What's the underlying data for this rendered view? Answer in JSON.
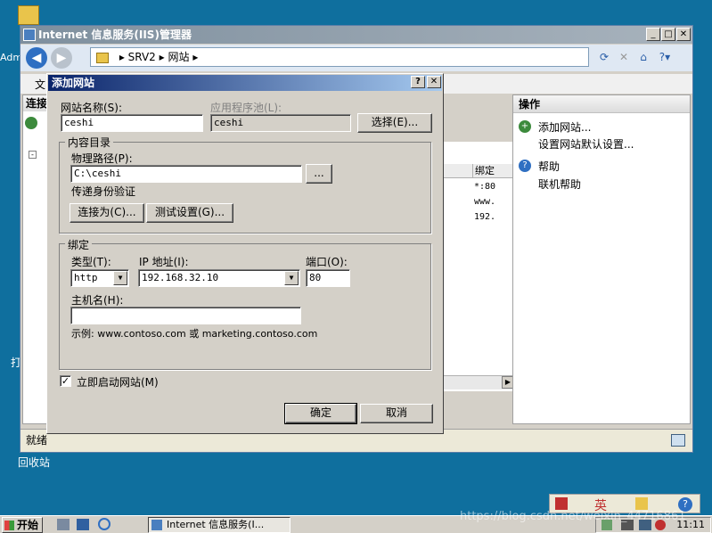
{
  "desktop": {
    "left_icon_text": "Adm",
    "recycle_bin_label": "回收站",
    "left_icon_text_2": "打"
  },
  "iis_window": {
    "title": "Internet 信息服务(IIS)管理器",
    "address_parts": [
      "SRV2",
      "网站"
    ],
    "menu_file": "文",
    "left_pane_header": "连接",
    "status_text": "就绪",
    "middle_pane": {
      "column_header": "绑定",
      "rows": [
        "*:80",
        "www.",
        "192."
      ]
    },
    "actions": {
      "header": "操作",
      "items": [
        {
          "label": "添加网站...",
          "icon": "globe-add-icon"
        },
        {
          "label": "设置网站默认设置...",
          "icon": ""
        }
      ],
      "help_items": [
        {
          "label": "帮助",
          "icon": "help-icon"
        },
        {
          "label": "联机帮助",
          "icon": ""
        }
      ]
    }
  },
  "dialog": {
    "title": "添加网站",
    "site_name_label": "网站名称(S):",
    "site_name_value": "ceshi",
    "app_pool_label": "应用程序池(L):",
    "app_pool_value": "ceshi",
    "select_button": "选择(E)...",
    "content_dir_group": "内容目录",
    "physical_path_label": "物理路径(P):",
    "physical_path_value": "C:\\ceshi",
    "browse_button": "...",
    "pass_through_label": "传递身份验证",
    "connect_as_button": "连接为(C)...",
    "test_settings_button": "测试设置(G)...",
    "binding_group": "绑定",
    "type_label": "类型(T):",
    "type_value": "http",
    "ip_label": "IP 地址(I):",
    "ip_value": "192.168.32.10",
    "port_label": "端口(O):",
    "port_value": "80",
    "hostname_label": "主机名(H):",
    "hostname_value": "",
    "example_text": "示例: www.contoso.com 或 marketing.contoso.com",
    "start_immediately_label": "立即启动网站(M)",
    "start_immediately_checked": true,
    "check_mark": "✓",
    "ok_button": "确定",
    "cancel_button": "取消",
    "help_button": "?",
    "close_button": "✕"
  },
  "taskbar": {
    "start_label": "开始",
    "task_item": "Internet 信息服务(I...",
    "clock": "11:11",
    "langbar_text": "英"
  },
  "watermark": "https://blog.csdn.net/weixin_44716861",
  "colors": {
    "desktop": "#0f6f9e",
    "dialog_title_start": "#0a246a",
    "dialog_title_end": "#a6caf0"
  }
}
